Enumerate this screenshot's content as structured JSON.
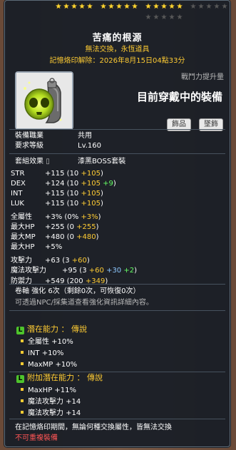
{
  "item": {
    "name": "苦痛的根源",
    "trade_status": "無法交換，永恆道具",
    "seal_release": "記憶烙印解除：2026年8月15日04點33分",
    "combat_power_label": "戰鬥力提升量",
    "combat_power_value": "目前穿戴中的裝備",
    "tags": [
      "飾品",
      "墜飾"
    ],
    "icon": "skull-pendant-icon"
  },
  "stars": {
    "filled": 15,
    "total": 20
  },
  "info": {
    "job_label": "裝備職業",
    "job_value": "共用",
    "level_label": "要求等級",
    "level_value": "Lv.160",
    "set_label": "套組效果",
    "set_value": "漆黑BOSS套裝"
  },
  "stats": [
    {
      "name": "STR",
      "total": "+115",
      "base": "10",
      "bonus": "+105",
      "extra": ""
    },
    {
      "name": "DEX",
      "total": "+124",
      "base": "10",
      "bonus": "+105",
      "extra": "+9"
    },
    {
      "name": "INT",
      "total": "+115",
      "base": "10",
      "bonus": "+105",
      "extra": ""
    },
    {
      "name": "LUK",
      "total": "+115",
      "base": "10",
      "bonus": "+105",
      "extra": ""
    },
    {
      "name": "全屬性",
      "total": "+3%",
      "base": "0%",
      "bonus": "+3%",
      "extra": ""
    },
    {
      "name": "最大HP",
      "total": "+255",
      "base": "0",
      "bonus": "+255",
      "extra": ""
    },
    {
      "name": "最大MP",
      "total": "+480",
      "base": "0",
      "bonus": "+480",
      "extra": ""
    },
    {
      "name": "最大HP",
      "total": "+5%",
      "base": "",
      "bonus": "",
      "extra": ""
    },
    {
      "name": "攻擊力",
      "total": "+63",
      "base": "3",
      "bonus": "+60",
      "extra": ""
    },
    {
      "name": "魔法攻擊力",
      "total": "+95",
      "base": "3",
      "bonus": "+60",
      "extra": "+30",
      "extra2": "+2"
    },
    {
      "name": "防禦力",
      "total": "+549",
      "base": "200",
      "bonus": "+349",
      "extra": ""
    }
  ],
  "scroll": {
    "line": "卷軸 強化 6次（剩餘0次，可恢復0次）",
    "note": "可透過NPC/採集道查看強化資訊詳細內容。"
  },
  "potential": {
    "badge": "L",
    "title": "潛在能力 ： 傳說",
    "lines": [
      "全屬性 +10%",
      "INT +10%",
      "MaxMP +10%"
    ]
  },
  "additional": {
    "badge": "L",
    "title": "附加潛在能力 ： 傳說",
    "lines": [
      "MaxHP +11%",
      "魔法攻擊力 +14",
      "魔法攻擊力 +14"
    ]
  },
  "footer": {
    "line1": "在記憶烙印期間，無論何種交換屬性，皆無法交換",
    "line2": "不可重複裝備"
  },
  "colors": {
    "gold": "#ffcc33",
    "green": "#66ff66",
    "blue": "#8ec8ff",
    "red": "#ff5555"
  }
}
